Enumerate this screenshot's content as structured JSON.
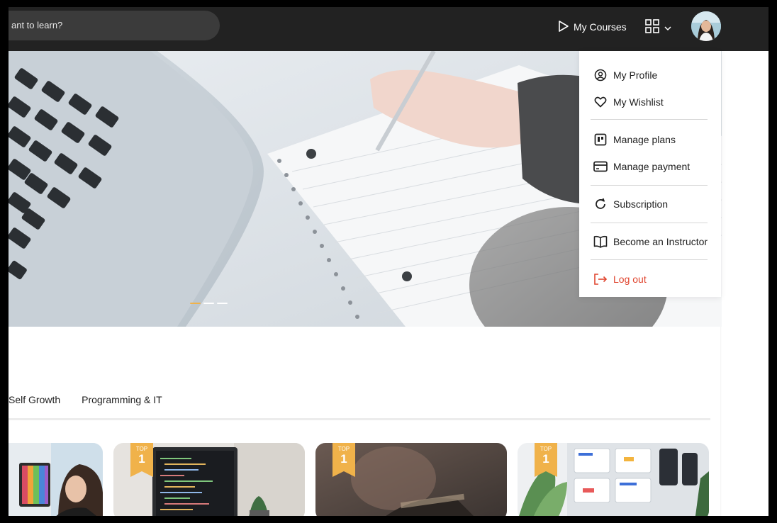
{
  "search": {
    "placeholder": "ant to learn?"
  },
  "header": {
    "my_courses_label": "My Courses"
  },
  "menu": {
    "items": [
      {
        "label": "My Profile",
        "icon": "user-circle-icon"
      },
      {
        "label": "My Wishlist",
        "icon": "heart-icon"
      },
      {
        "label": "Manage plans",
        "icon": "plans-icon"
      },
      {
        "label": "Manage payment",
        "icon": "credit-card-icon"
      },
      {
        "label": "Subscription",
        "icon": "refresh-icon"
      },
      {
        "label": "Become an Instructor",
        "icon": "book-icon"
      },
      {
        "label": "Log out",
        "icon": "logout-icon"
      }
    ]
  },
  "tabs": [
    "Self Growth",
    "Programming & IT"
  ],
  "cards": [
    {
      "badge": null
    },
    {
      "badge_top": "TOP",
      "badge_num": "1"
    },
    {
      "badge_top": "TOP",
      "badge_num": "1"
    },
    {
      "badge_top": "TOP",
      "badge_num": "1"
    }
  ],
  "colors": {
    "topbar": "#222222",
    "accent": "#f0b24a",
    "logout": "#e0452f"
  }
}
